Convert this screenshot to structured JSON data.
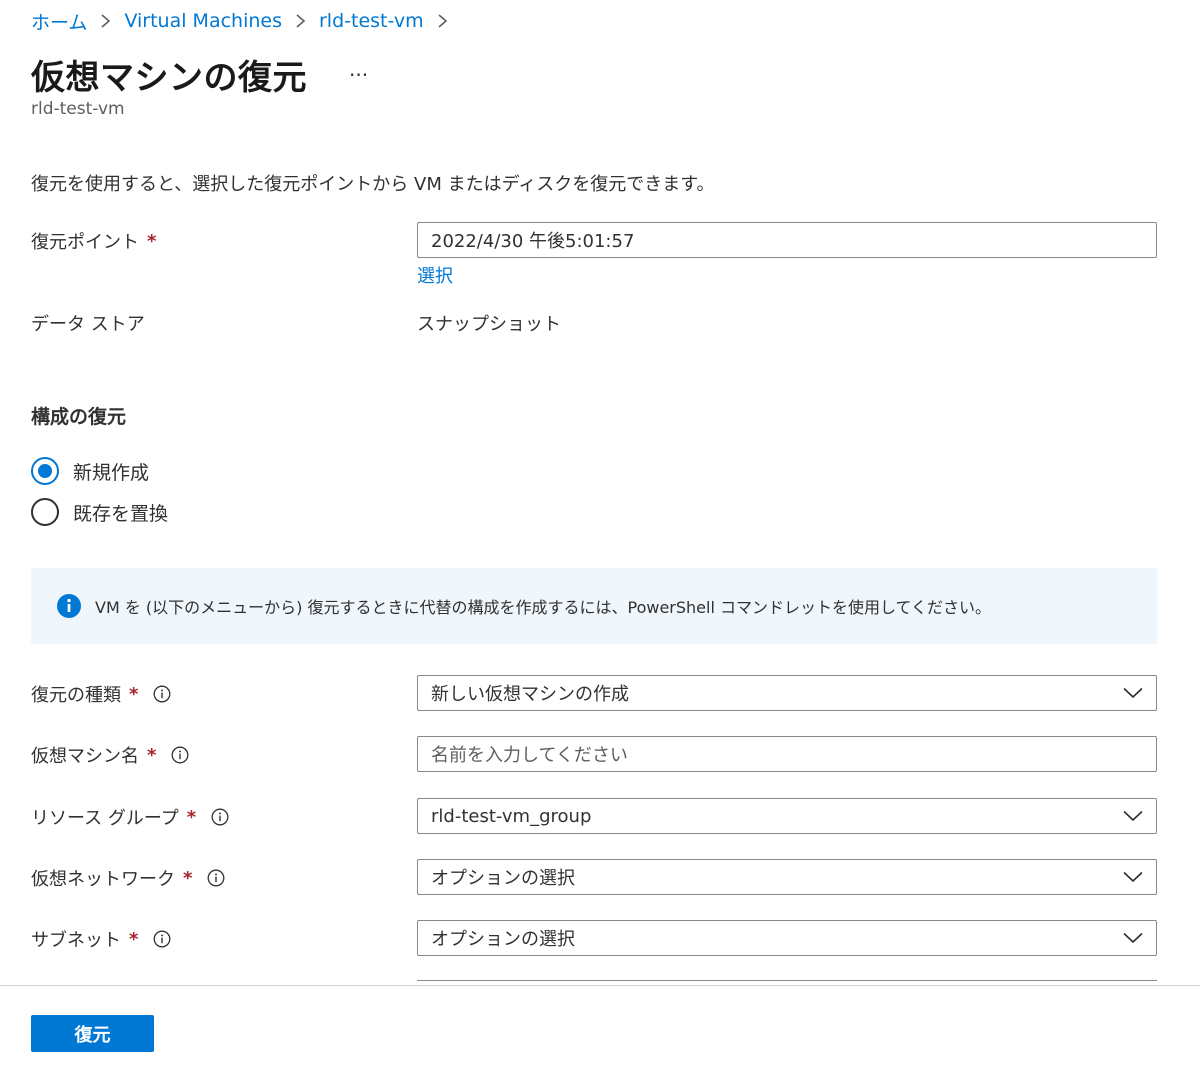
{
  "breadcrumb": [
    "ホーム",
    "Virtual Machines",
    "rld-test-vm"
  ],
  "page": {
    "title": "仮想マシンの復元",
    "more_label": "···",
    "subtitle": "rld-test-vm"
  },
  "description": "復元を使用すると、選択した復元ポイントから VM またはディスクを復元できます。",
  "restore_point": {
    "label": "復元ポイント",
    "value": "2022/4/30 午後5:01:57",
    "select_link": "選択"
  },
  "data_store": {
    "label": "データ ストア",
    "value": "スナップショット"
  },
  "required_marker": "*",
  "config_section": {
    "title": "構成の復元",
    "options": [
      {
        "label": "新規作成",
        "checked": true
      },
      {
        "label": "既存を置換",
        "checked": false
      }
    ]
  },
  "info_banner": {
    "text": "VM を (以下のメニューから) 復元するときに代替の構成を作成するには、PowerShell コマンドレットを使用してください。"
  },
  "form": {
    "restore_type": {
      "label": "復元の種類",
      "value": "新しい仮想マシンの作成"
    },
    "vm_name": {
      "label": "仮想マシン名",
      "placeholder": "名前を入力してください"
    },
    "resource_group": {
      "label": "リソース グループ",
      "value": "rld-test-vm_group"
    },
    "virtual_network": {
      "label": "仮想ネットワーク",
      "value": "オプションの選択"
    },
    "subnet": {
      "label": "サブネット",
      "value": "オプションの選択"
    }
  },
  "footer": {
    "restore_button": "復元"
  },
  "colors": {
    "accent": "#0078d4",
    "required": "#a4262c",
    "banner_bg": "#eff6fc"
  }
}
